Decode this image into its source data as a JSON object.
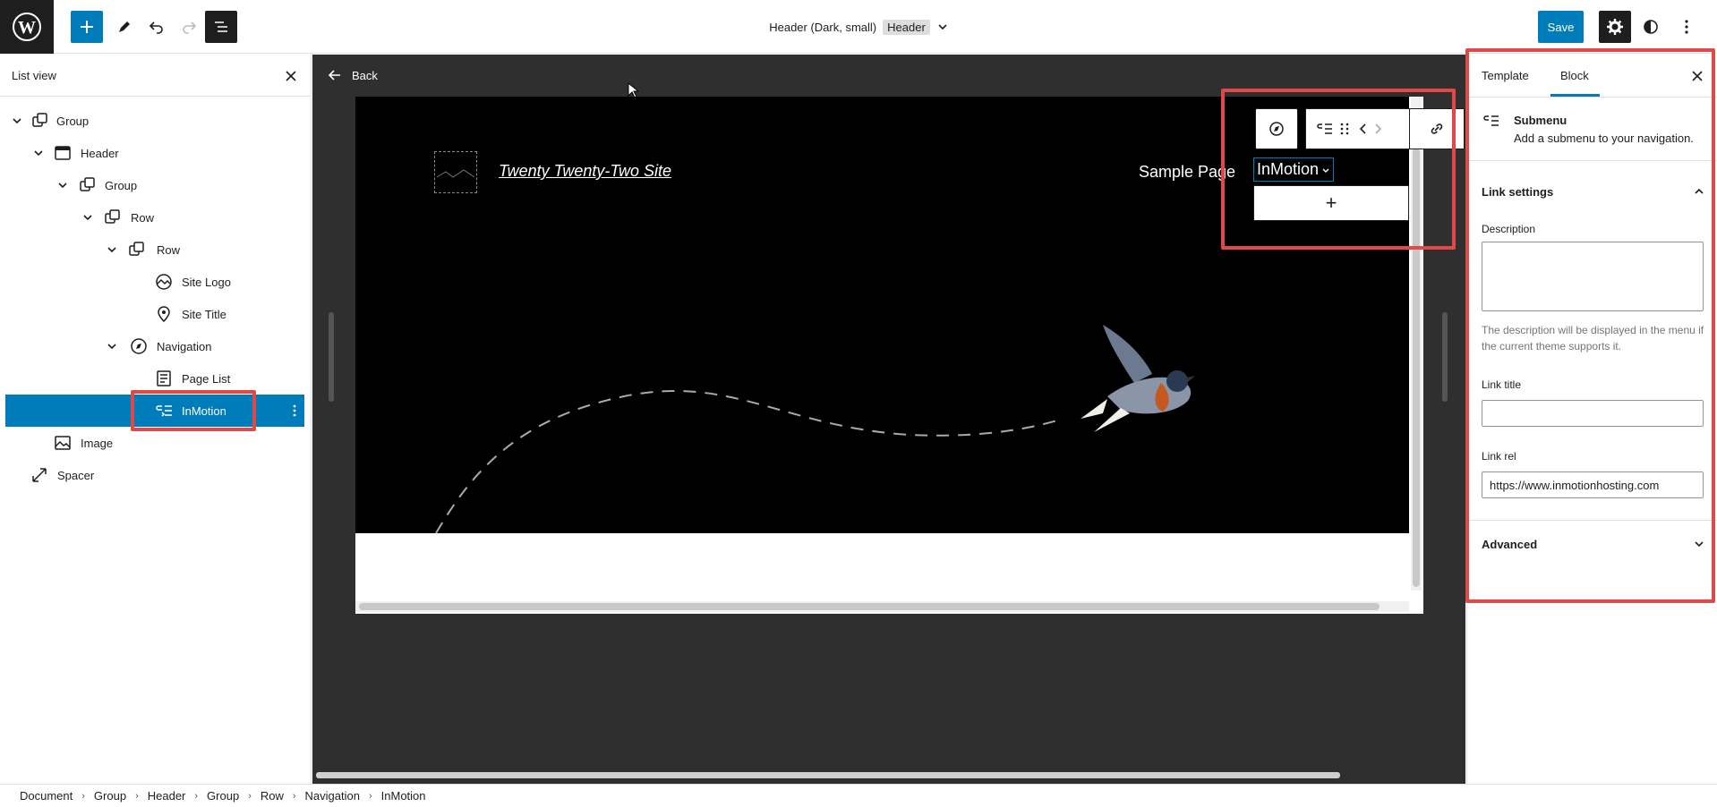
{
  "topbar": {
    "doc_title": "Header (Dark, small)",
    "doc_type_badge": "Header",
    "save_label": "Save"
  },
  "list_view": {
    "title": "List view",
    "items": [
      {
        "label": "Group",
        "icon": "group-icon"
      },
      {
        "label": "Header",
        "icon": "template-part-icon"
      },
      {
        "label": "Group",
        "icon": "group-icon"
      },
      {
        "label": "Row",
        "icon": "row-icon"
      },
      {
        "label": "Row",
        "icon": "row-icon"
      },
      {
        "label": "Site Logo",
        "icon": "site-logo-icon"
      },
      {
        "label": "Site Title",
        "icon": "site-title-icon"
      },
      {
        "label": "Navigation",
        "icon": "navigation-icon"
      },
      {
        "label": "Page List",
        "icon": "page-list-icon"
      },
      {
        "label": "InMotion",
        "icon": "submenu-icon",
        "selected": true
      },
      {
        "label": "Image",
        "icon": "image-icon"
      },
      {
        "label": "Spacer",
        "icon": "spacer-icon"
      }
    ]
  },
  "canvas": {
    "back_label": "Back",
    "site_title": "Twenty Twenty-Two Site",
    "nav_items": [
      "Sample Page",
      "InMotion"
    ],
    "add_block_label": "+"
  },
  "sidebar": {
    "tabs": [
      "Template",
      "Block"
    ],
    "active_tab": "Block",
    "block_name": "Submenu",
    "block_description": "Add a submenu to your navigation.",
    "link_settings_title": "Link settings",
    "description_label": "Description",
    "description_value": "",
    "description_help": "The description will be displayed in the menu if the current theme supports it.",
    "link_title_label": "Link title",
    "link_title_value": "",
    "link_rel_label": "Link rel",
    "link_rel_value": "https://www.inmotionhosting.com",
    "advanced_title": "Advanced"
  },
  "breadcrumbs": [
    "Document",
    "Group",
    "Header",
    "Group",
    "Row",
    "Navigation",
    "InMotion"
  ],
  "colors": {
    "accent": "#007cba",
    "highlight": "#e0494a",
    "canvas_bg": "#2f2f2f",
    "hero_bg": "#000000"
  }
}
